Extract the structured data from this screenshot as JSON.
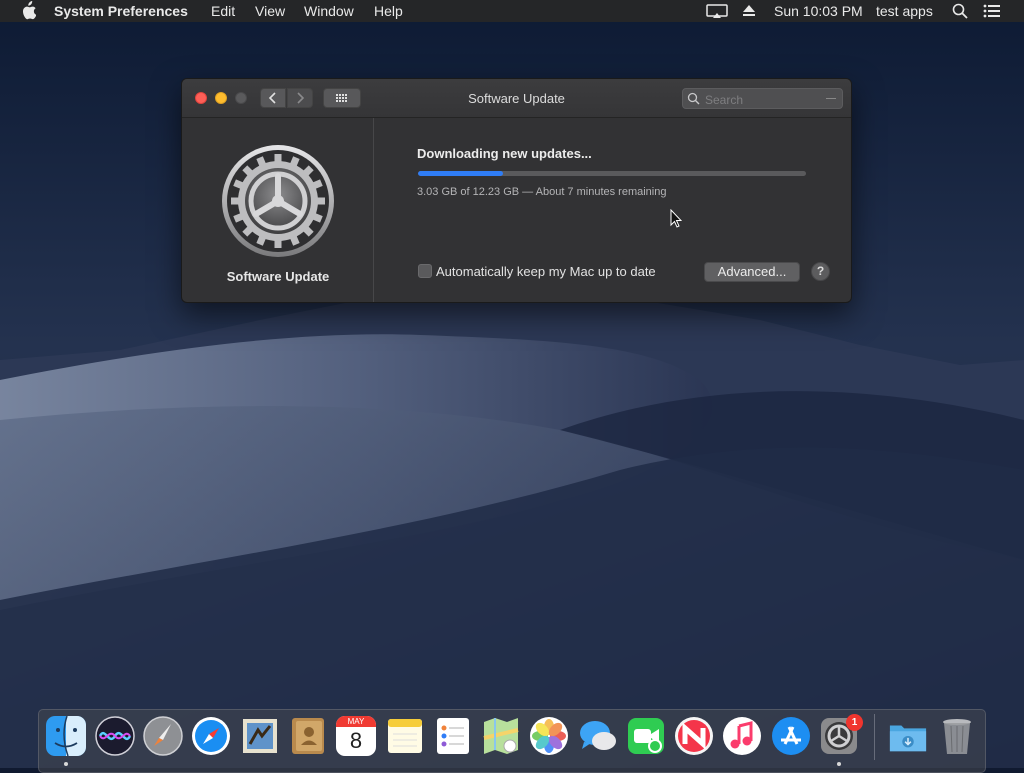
{
  "menubar": {
    "app_name": "System Preferences",
    "items": [
      "Edit",
      "View",
      "Window",
      "Help"
    ],
    "clock": "Sun 10:03 PM",
    "user": "test apps"
  },
  "window": {
    "title": "Software Update",
    "search_placeholder": "Search",
    "sidebar_label": "Software Update",
    "download": {
      "title": "Downloading new updates...",
      "progress_fraction": 0.22,
      "status": "3.03 GB of 12.23 GB — About 7 minutes remaining"
    },
    "auto_update_label": "Automatically keep my Mac up to date",
    "auto_update_checked": false,
    "advanced_button": "Advanced...",
    "help_button": "?"
  },
  "dock": {
    "system_preferences_badge": "1",
    "calendar_month": "MAY",
    "calendar_day": "8",
    "icons": [
      "finder-icon",
      "siri-icon",
      "launchpad-icon",
      "safari-icon",
      "mail-icon",
      "contacts-icon",
      "calendar-icon",
      "notes-icon",
      "reminders-icon",
      "maps-icon",
      "photos-icon",
      "messages-icon",
      "facetime-icon",
      "news-icon",
      "itunes-icon",
      "app-store-icon",
      "system-preferences-icon",
      "downloads-folder-icon",
      "trash-icon"
    ]
  },
  "colors": {
    "accent": "#2f7df6",
    "close": "#fd5f57",
    "minimize": "#febc2e",
    "badge": "#f0352e"
  }
}
